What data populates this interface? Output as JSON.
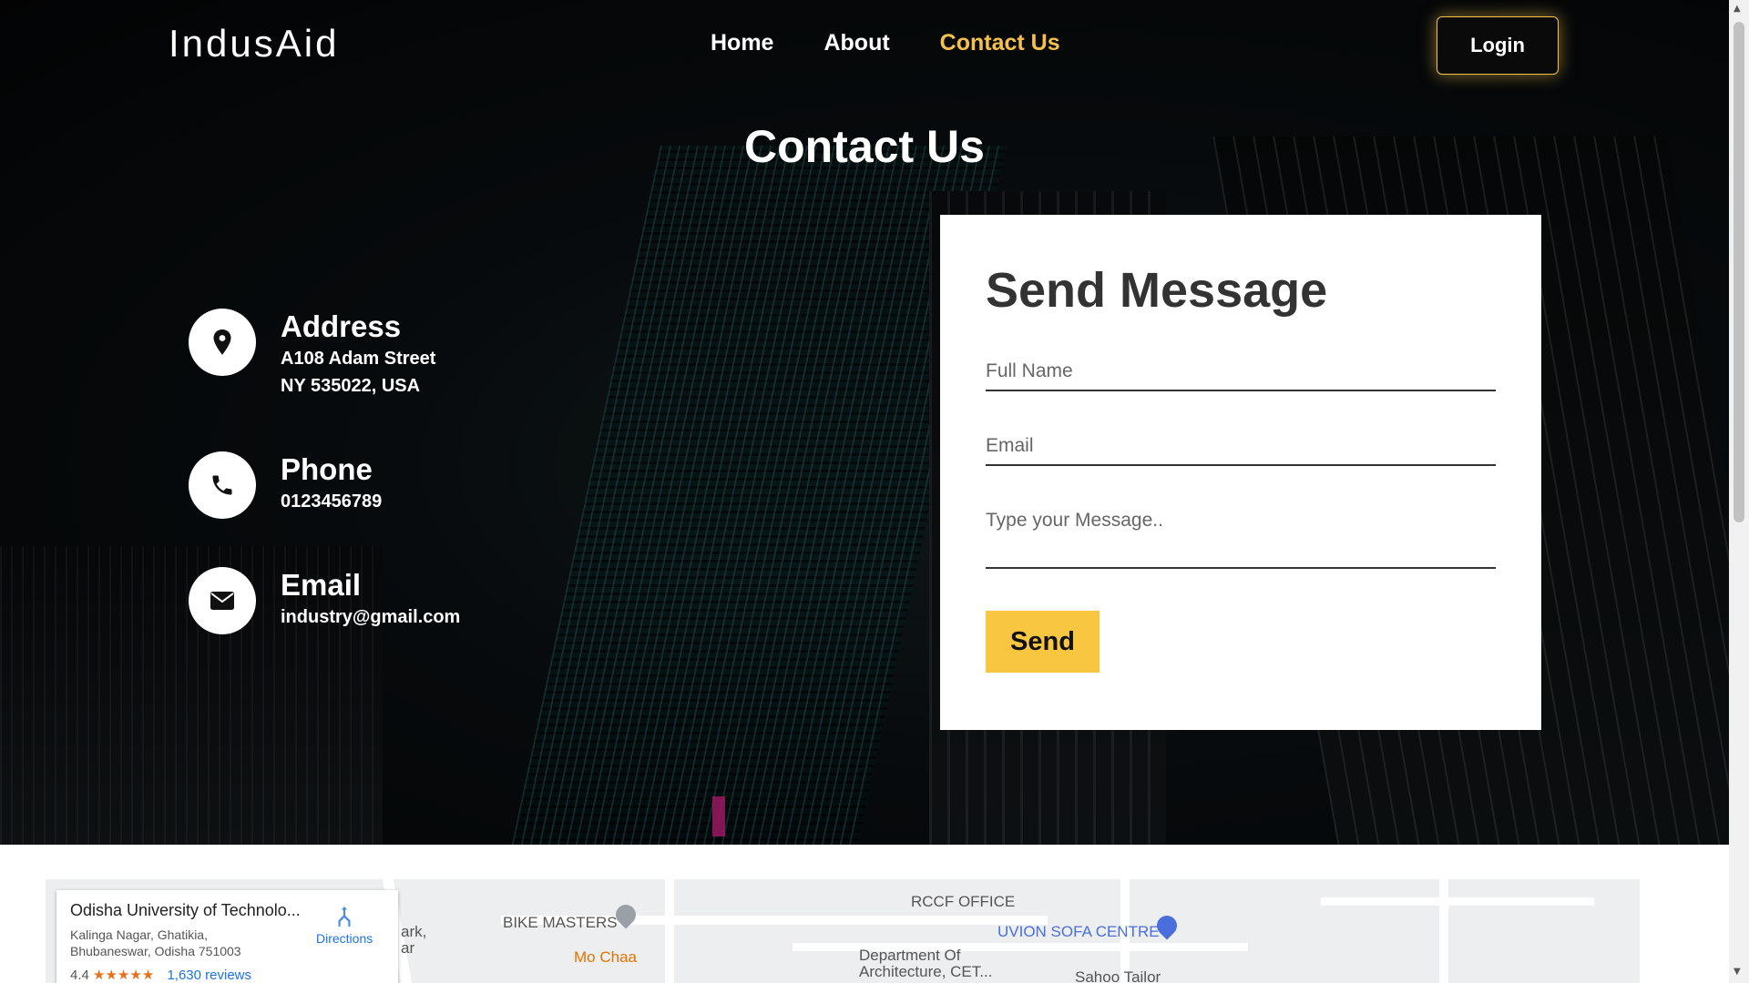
{
  "nav": {
    "logo": "IndusAid",
    "items": [
      {
        "label": "Home",
        "active": false
      },
      {
        "label": "About",
        "active": false
      },
      {
        "label": "Contact Us",
        "active": true
      }
    ],
    "login_label": "Login"
  },
  "page_title": "Contact Us",
  "contact_info": {
    "address": {
      "heading": "Address",
      "lines": [
        "A108 Adam Street",
        "NY 535022, USA"
      ],
      "icon": "map-pin-icon"
    },
    "phone": {
      "heading": "Phone",
      "value": "0123456789",
      "icon": "phone-icon"
    },
    "email": {
      "heading": "Email",
      "value": "industry@gmail.com",
      "icon": "envelope-icon"
    }
  },
  "form": {
    "title": "Send Message",
    "full_name_placeholder": "Full Name",
    "email_placeholder": "Email",
    "message_placeholder": "Type your Message..",
    "send_label": "Send"
  },
  "map": {
    "place_name": "Odisha University of Technolo...",
    "address_line1": "Kalinga Nagar, Ghatikia,",
    "address_line2": "Bhubaneswar, Odisha 751003",
    "rating": "4.4",
    "stars": "★★★★★",
    "reviews": "1,630 reviews",
    "directions_label": "Directions",
    "labels": [
      "BIKE MASTERS",
      "Mo Chaa",
      "RCCF OFFICE",
      "UVION SOFA CENTRE",
      "Department Of",
      "Architecture, CET...",
      "Sahoo Tailor",
      "ark,",
      "ar"
    ]
  },
  "colors": {
    "accent": "#f5c14a",
    "send_button": "#f9c642",
    "form_bg": "#ffffff"
  }
}
